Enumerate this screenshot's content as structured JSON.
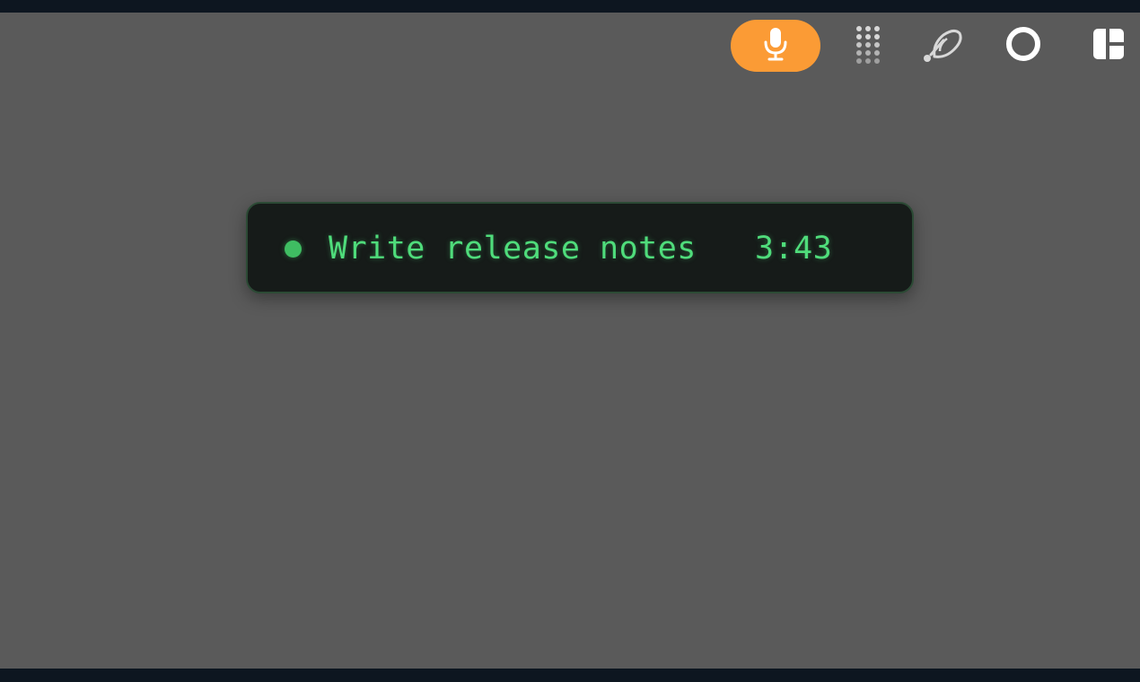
{
  "menubar": {
    "icons": [
      {
        "name": "microphone-icon",
        "active": true,
        "accent": "#fb9b35"
      },
      {
        "name": "dot-grid-icon"
      },
      {
        "name": "satellite-dish-icon"
      },
      {
        "name": "circle-icon"
      },
      {
        "name": "layout-icon"
      }
    ]
  },
  "timer_widget": {
    "task": "Write release notes",
    "time": "3:43",
    "status_color": "#3fbd62",
    "text_color": "#4fdc7b"
  },
  "colors": {
    "background": "#5a5a5a",
    "strip": "#0d1620",
    "widget_background": "#161b19",
    "widget_border": "#2c4a35"
  }
}
